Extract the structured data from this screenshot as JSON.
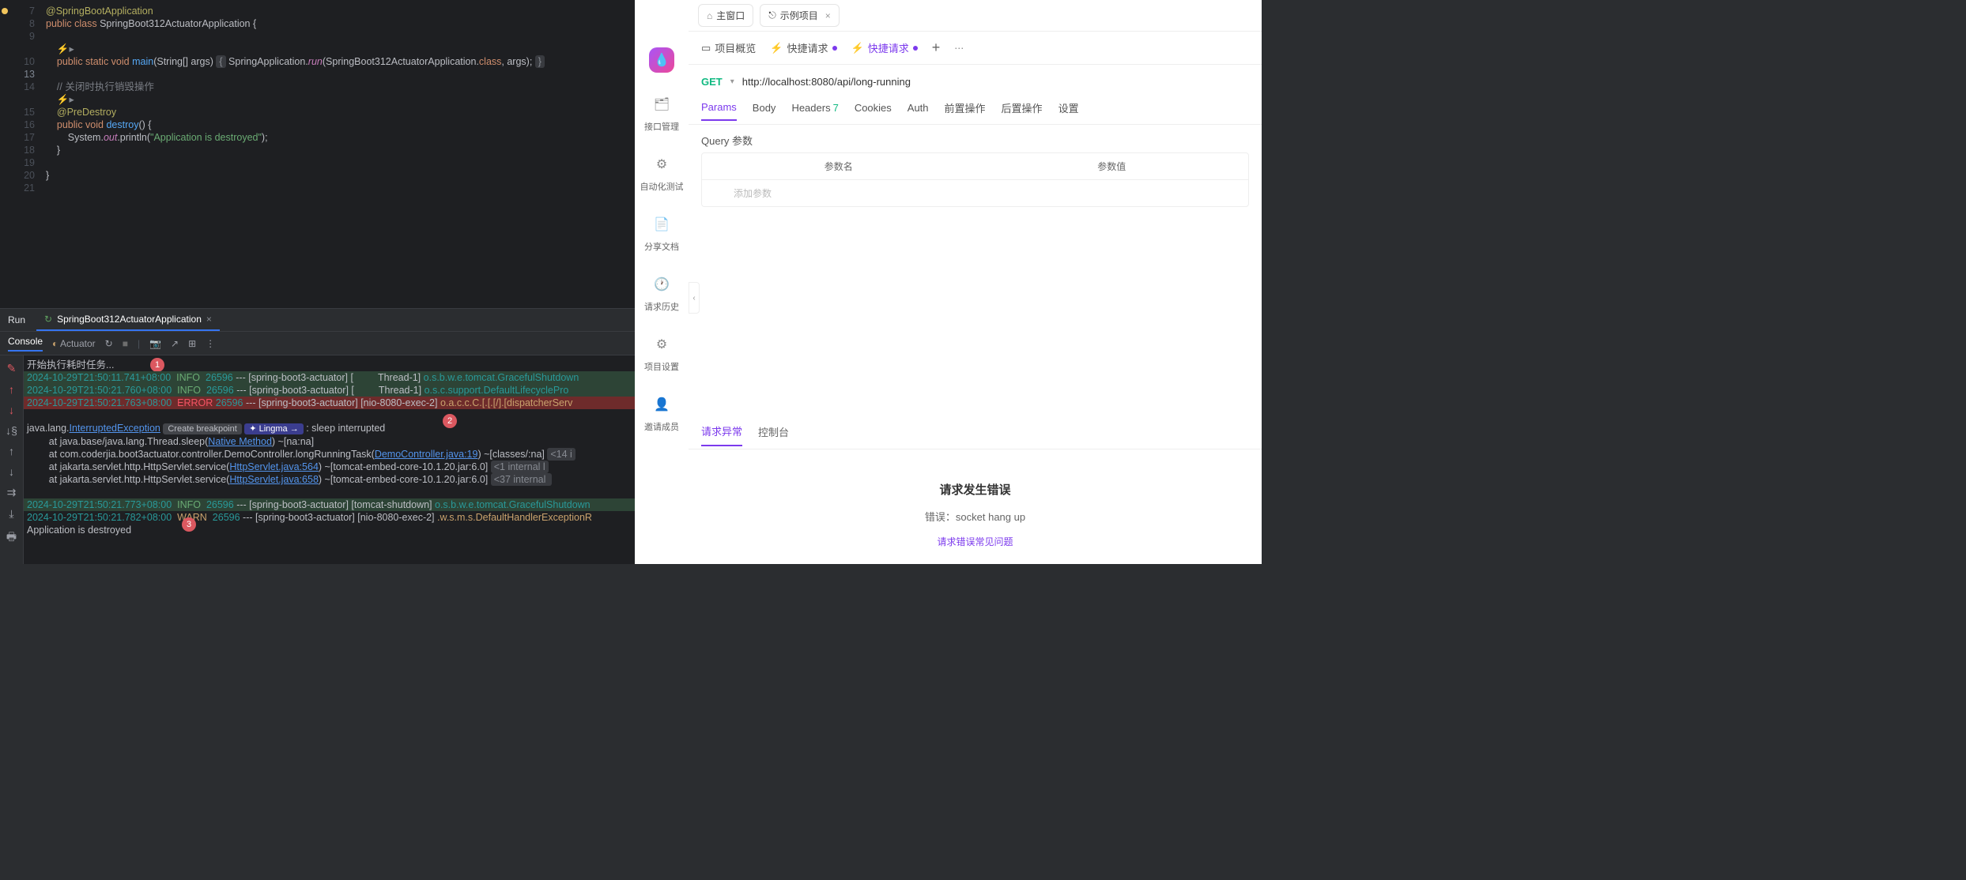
{
  "editor": {
    "lines": [
      {
        "n": 7,
        "icon": "dot",
        "html": "<span class='c-ann'>@SpringBootApplication</span>"
      },
      {
        "n": 8,
        "icon": "run",
        "html": "<span class='c-kw'>public class </span><span class='c-cls'>SpringBoot312ActuatorApplication {</span>"
      },
      {
        "n": 9,
        "html": ""
      },
      {
        "n": "",
        "html": "    <span class='dim'>⚡▸</span>"
      },
      {
        "n": 10,
        "icon": "run",
        "html": "    <span class='c-kw'>public static void </span><span class='c-mth'>main</span>(String[] args) <span class='hint-box'>{</span> SpringApplication.<span class='c-sta'>run</span>(SpringBoot312ActuatorApplication.<span class='c-kw'>class</span>, args); <span class='hint-box'>}</span>"
      },
      {
        "n": 13,
        "hl": true,
        "html": ""
      },
      {
        "n": 14,
        "html": "    <span class='c-cmt'>// 关闭时执行销毁操作</span>"
      },
      {
        "n": "",
        "html": "    <span class='dim'>⚡▸</span>"
      },
      {
        "n": 15,
        "html": "    <span class='c-ann'>@PreDestroy</span>"
      },
      {
        "n": 16,
        "html": "    <span class='c-kw'>public void </span><span class='c-mth'>destroy</span>() {"
      },
      {
        "n": 17,
        "html": "        System.<span class='c-sta'>out</span>.println(<span class='c-str'>\"Application is destroyed\"</span>);"
      },
      {
        "n": 18,
        "html": "    }"
      },
      {
        "n": 19,
        "html": ""
      },
      {
        "n": 20,
        "html": "}"
      },
      {
        "n": 21,
        "html": ""
      }
    ]
  },
  "run": {
    "title": "Run",
    "tab": "SpringBoot312ActuatorApplication",
    "toolbar": {
      "console": "Console",
      "actuator": "Actuator"
    },
    "firstLine": "开始执行耗时任务...",
    "logs": [
      {
        "bg": "green-bg",
        "ts": "2024-10-29T21:50:11.741+08:00",
        "lv": "INFO",
        "lvc": "lv-info",
        "pid": "26596",
        "app": "[spring-boot3-actuator]",
        "thr": "[         Thread-1]",
        "lg": "o.s.b.w.e.tomcat.GracefulShutdown",
        "lgc": "lg"
      },
      {
        "bg": "green-bg",
        "ts": "2024-10-29T21:50:21.760+08:00",
        "lv": "INFO",
        "lvc": "lv-info",
        "pid": "26596",
        "app": "[spring-boot3-actuator]",
        "thr": "[         Thread-1]",
        "lg": "o.s.c.support.DefaultLifecyclePro",
        "lgc": "lg"
      },
      {
        "bg": "red-bg",
        "ts": "2024-10-29T21:50:21.763+08:00",
        "lv": "ERROR",
        "lvc": "lv-err",
        "pid": "26596",
        "app": "[spring-boot3-actuator]",
        "thr": "[nio-8080-exec-2]",
        "lg": "o.a.c.c.C.[.[.[/].[dispatcherServ",
        "lgc": "lg-y"
      }
    ],
    "ex": {
      "head": "java.lang.",
      "name": "InterruptedException",
      "bp": "Create breakpoint",
      "lingma": "Lingma →",
      "tail": " : sleep interrupted",
      "stack": [
        "        at java.base/java.lang.Thread.sleep(<span class='link'>Native Method</span>) ~[na:na]",
        "        at com.coderjia.boot3actuator.controller.DemoController.longRunningTask(<span class='link'>DemoController.java:19</span>) ~[classes/:na] <span class='hint-box'>&lt;14 i</span>",
        "        at jakarta.servlet.http.HttpServlet.service(<span class='link'>HttpServlet.java:564</span>) ~[tomcat-embed-core-10.1.20.jar:6.0] <span class='hint-box'>&lt;1 internal l</span>",
        "        at jakarta.servlet.http.HttpServlet.service(<span class='link'>HttpServlet.java:658</span>) ~[tomcat-embed-core-10.1.20.jar:6.0] <span class='hint-box'>&lt;37 internal </span>"
      ]
    },
    "logs2": [
      {
        "bg": "green-bg",
        "ts": "2024-10-29T21:50:21.773+08:00",
        "lv": "INFO",
        "lvc": "lv-info",
        "pid": "26596",
        "app": "[spring-boot3-actuator]",
        "thr": "[tomcat-shutdown]",
        "lg": "o.s.b.w.e.tomcat.GracefulShutdown",
        "lgc": "lg"
      },
      {
        "bg": "",
        "ts": "2024-10-29T21:50:21.782+08:00",
        "lv": "WARN",
        "lvc": "lv-warn",
        "pid": "26596",
        "app": "[spring-boot3-actuator]",
        "thr": "[nio-8080-exec-2]",
        "lg": ".w.s.m.s.DefaultHandlerExceptionR",
        "lgc": "lg-y"
      }
    ],
    "destroyed": "Application is destroyed"
  },
  "rp": {
    "tabs": {
      "main": "主窗口",
      "example": "示例项目"
    },
    "sidebar": [
      {
        "icon": "brand",
        "label": ""
      },
      {
        "icon": "🗂",
        "label": "接口管理"
      },
      {
        "icon": "⚙",
        "label": "自动化测试"
      },
      {
        "icon": "📄",
        "label": "分享文档"
      },
      {
        "icon": "🕐",
        "label": "请求历史"
      },
      {
        "icon": "⚙",
        "label": "项目设置"
      },
      {
        "icon": "👤",
        "label": "邀请成员"
      }
    ],
    "row2": [
      {
        "icon": "▭",
        "label": "项目概览"
      },
      {
        "icon": "⚡",
        "label": "快捷请求",
        "dot": true
      },
      {
        "icon": "⚡",
        "label": "快捷请求",
        "dot": true,
        "active": true
      }
    ],
    "method": "GET",
    "url": "http://localhost:8080/api/long-running",
    "reqtabs": [
      {
        "l": "Params",
        "active": true
      },
      {
        "l": "Body"
      },
      {
        "l": "Headers",
        "c": "7"
      },
      {
        "l": "Cookies"
      },
      {
        "l": "Auth"
      },
      {
        "l": "前置操作"
      },
      {
        "l": "后置操作"
      },
      {
        "l": "设置"
      }
    ],
    "query": {
      "title": "Query 参数",
      "col1": "参数名",
      "col2": "参数值",
      "ph": "添加参数"
    },
    "btabs": [
      {
        "l": "请求异常",
        "active": true
      },
      {
        "l": "控制台"
      }
    ],
    "err": {
      "title": "请求发生错误",
      "msg": "错误：socket hang up",
      "link": "请求错误常见问题"
    }
  }
}
